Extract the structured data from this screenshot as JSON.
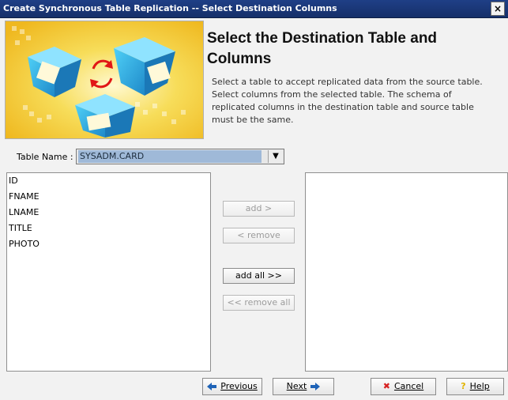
{
  "window": {
    "title": "Create Synchronous Table Replication -- Select Destination Columns"
  },
  "header": {
    "heading_line1": "Select the Destination Table and",
    "heading_line2": "Columns",
    "description": "Select a table to accept replicated data from the source table. Select columns from the selected table. The schema of replicated columns in the destination table and source table must be the same."
  },
  "table_selector": {
    "label": "Table Name :",
    "value": "SYSADM.CARD"
  },
  "available_columns": [
    "ID",
    "FNAME",
    "LNAME",
    "TITLE",
    "PHOTO"
  ],
  "selected_columns": [],
  "transfer_buttons": {
    "add": "add >",
    "remove": "< remove",
    "add_all": "add all >>",
    "remove_all": "<< remove all"
  },
  "footer": {
    "previous": "Previous",
    "next": "Next",
    "cancel": "Cancel",
    "help": "Help"
  },
  "colors": {
    "title_bar": "#1f3f86",
    "selection": "#9fb9d8",
    "banner": "#f2c72c"
  },
  "icons": [
    "close-icon",
    "banner-illustration",
    "chevron-down-icon",
    "previous-arrow-icon",
    "next-arrow-icon",
    "cancel-x-icon",
    "help-icon"
  ]
}
